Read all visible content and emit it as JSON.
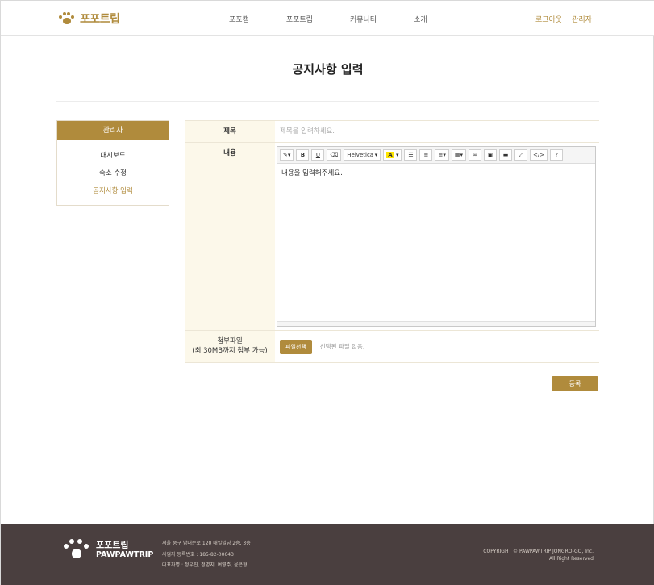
{
  "header": {
    "logo_text": "포포트립",
    "nav": [
      "포포캠",
      "포포트립",
      "커뮤니티",
      "소개"
    ],
    "util": [
      "로그아웃",
      "관리자"
    ]
  },
  "page": {
    "title": "공지사항 입력"
  },
  "sidebar": {
    "title": "관리자",
    "items": [
      {
        "label": "대시보드",
        "active": false
      },
      {
        "label": "숙소 수정",
        "active": false
      },
      {
        "label": "공지사항 입력",
        "active": true
      }
    ]
  },
  "form": {
    "title_label": "제목",
    "title_placeholder": "제목을 입력하세요.",
    "content_label": "내용",
    "content_text": "내용을 입력해주세요.",
    "font_select": "Helvetica",
    "attach_label_line1": "첨부파일",
    "attach_label_line2": "(최 30MB까지 첨부 가능)",
    "file_button": "파일선택",
    "file_status": "선택된 파일 없음.",
    "submit_label": "등록"
  },
  "toolbar_icons": [
    "magic-icon",
    "bold-icon",
    "underline-icon",
    "eraser-icon",
    "font-select",
    "text-color-icon",
    "unordered-list-icon",
    "ordered-list-icon",
    "align-icon",
    "table-icon",
    "link-icon",
    "image-icon",
    "video-icon",
    "fullscreen-icon",
    "code-view-icon",
    "help-icon"
  ],
  "footer": {
    "name_ko": "포포트립",
    "name_en": "PAWPAWTRIP",
    "address": "서울 중구 남대문로 120 대일빌딩 2층, 3층",
    "business_no": "사업자 등록번호 : 185-82-00643",
    "representatives": "대표자명 : 정우진, 정명지, 여영주, 윤은형",
    "copyright_line1": "COPYRIGHT © PAWPAWTRIP JONGRO-GO, Inc.",
    "copyright_line2": "All Right Reserved"
  },
  "colors": {
    "accent": "#b08b3c",
    "label_bg": "#fcf8ea",
    "footer_bg": "#4a3f3f"
  }
}
